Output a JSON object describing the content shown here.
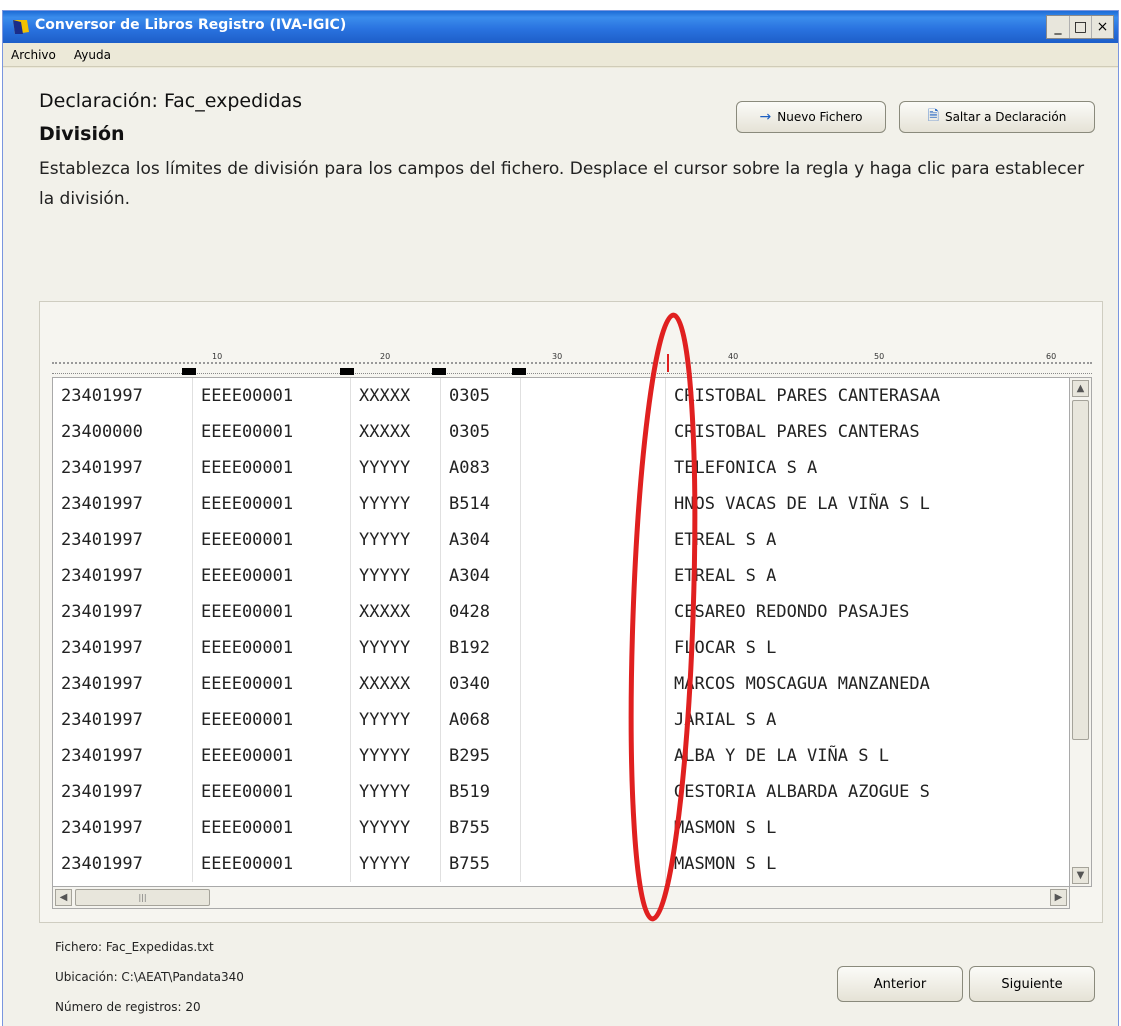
{
  "window": {
    "title": "Conversor de Libros Registro (IVA-IGIC)",
    "buttons": [
      "_",
      "□",
      "×"
    ]
  },
  "menu": [
    "Archivo",
    "Ayuda"
  ],
  "heading": "Declaración: Fac_expedidas",
  "subheading": "División",
  "description": "Establezca los límites de división para los campos del fichero. Desplace el cursor sobre la regla y haga clic para establecer la división.",
  "actions": {
    "new_file": "Nuevo Fichero",
    "jump": "Saltar a Declaración",
    "prev": "Anterior",
    "next": "Siguiente"
  },
  "ruler": {
    "ticks": [
      "10",
      "20",
      "30",
      "40",
      "50",
      "60"
    ]
  },
  "rows": [
    [
      "23401997",
      "EEEE00001",
      "XXXXX",
      "0305",
      "",
      "CRISTOBAL PARES CANTERASAA"
    ],
    [
      "23400000",
      "EEEE00001",
      "XXXXX",
      "0305",
      "",
      "CRISTOBAL PARES CANTERAS"
    ],
    [
      "23401997",
      "EEEE00001",
      "YYYYY",
      "A083",
      "",
      "TELEFONICA S A"
    ],
    [
      "23401997",
      "EEEE00001",
      "YYYYY",
      "B514",
      "",
      "HNOS VACAS DE LA VIÑA S L"
    ],
    [
      "23401997",
      "EEEE00001",
      "YYYYY",
      "A304",
      "",
      "ETREAL S A"
    ],
    [
      "23401997",
      "EEEE00001",
      "YYYYY",
      "A304",
      "",
      "ETREAL S A"
    ],
    [
      "23401997",
      "EEEE00001",
      "XXXXX",
      "0428",
      "",
      "CESAREO REDONDO PASAJES"
    ],
    [
      "23401997",
      "EEEE00001",
      "YYYYY",
      "B192",
      "",
      "FLOCAR S L"
    ],
    [
      "23401997",
      "EEEE00001",
      "XXXXX",
      "0340",
      "",
      "MARCOS MOSCAGUA MANZANEDA"
    ],
    [
      "23401997",
      "EEEE00001",
      "YYYYY",
      "A068",
      "",
      "JARIAL S A"
    ],
    [
      "23401997",
      "EEEE00001",
      "YYYYY",
      "B295",
      "",
      "ALBA Y DE LA VIÑA S L"
    ],
    [
      "23401997",
      "EEEE00001",
      "YYYYY",
      "B519",
      "",
      "GESTORIA ALBARDA AZOGUE S"
    ],
    [
      "23401997",
      "EEEE00001",
      "YYYYY",
      "B755",
      "",
      "MASMON S L"
    ],
    [
      "23401997",
      "EEEE00001",
      "YYYYY",
      "B755",
      "",
      "MASMON S L"
    ]
  ],
  "info": {
    "file": "Fichero: Fac_Expedidas.txt",
    "location": "Ubicación: C:\\AEAT\\Pandata340",
    "count": "Número de registros: 20"
  },
  "colors": {
    "title_bar": "#2a73e0",
    "annotation": "#e02020"
  }
}
